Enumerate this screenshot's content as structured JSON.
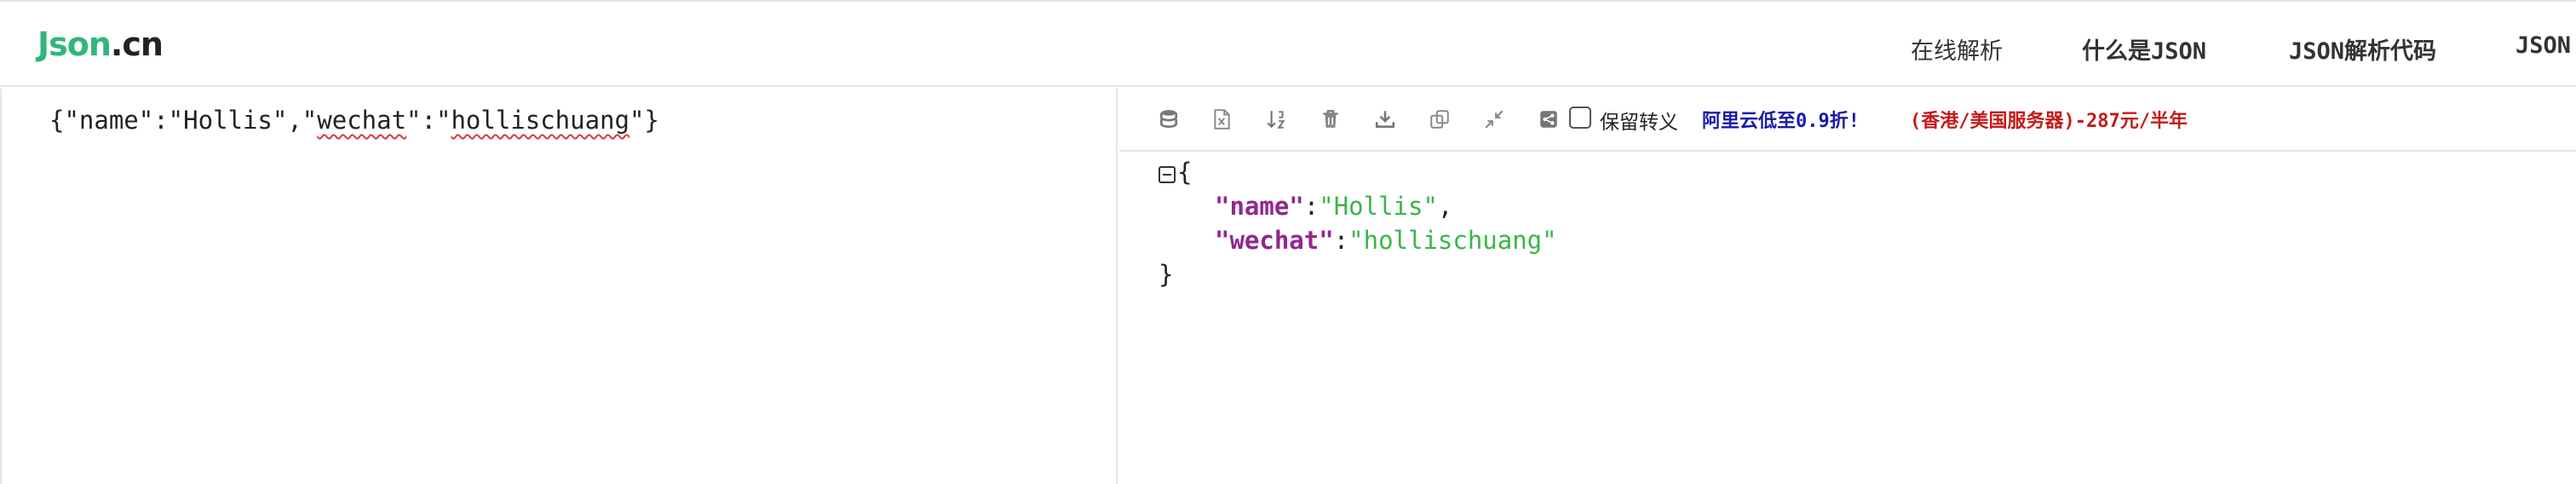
{
  "header": {
    "logo_primary": "Json",
    "logo_secondary": ".cn",
    "nav": [
      {
        "label": "在线解析"
      },
      {
        "label": "什么是JSON"
      },
      {
        "label": "JSON解析代码"
      },
      {
        "label": "JSON"
      }
    ]
  },
  "editor": {
    "parts": [
      "{\"name\":\"Hollis\",\"",
      "wechat",
      "\":\"",
      "hollischuang",
      "\"}"
    ]
  },
  "toolbar": {
    "icons": [
      "database-icon",
      "excel-icon",
      "sort-icon",
      "trash-icon",
      "download-icon",
      "copy-icon",
      "compress-icon",
      "share-icon"
    ],
    "checkbox_label": "保留转义",
    "ad_text_1": "阿里云低至0.9折!",
    "ad_text_2": "(香港/美国服务器)-287元/半年",
    "colors": {
      "ad1": "#1a1aa8",
      "ad2": "#c41a1a"
    }
  },
  "tree": {
    "open_brace": "{",
    "close_brace": "}",
    "entries": [
      {
        "key": "\"name\"",
        "colon": ":",
        "value": "\"Hollis\"",
        "trail": ","
      },
      {
        "key": "\"wechat\"",
        "colon": ":",
        "value": "\"hollischuang\"",
        "trail": ""
      }
    ],
    "colors": {
      "key": "#92278f",
      "string": "#3ab54a"
    }
  }
}
